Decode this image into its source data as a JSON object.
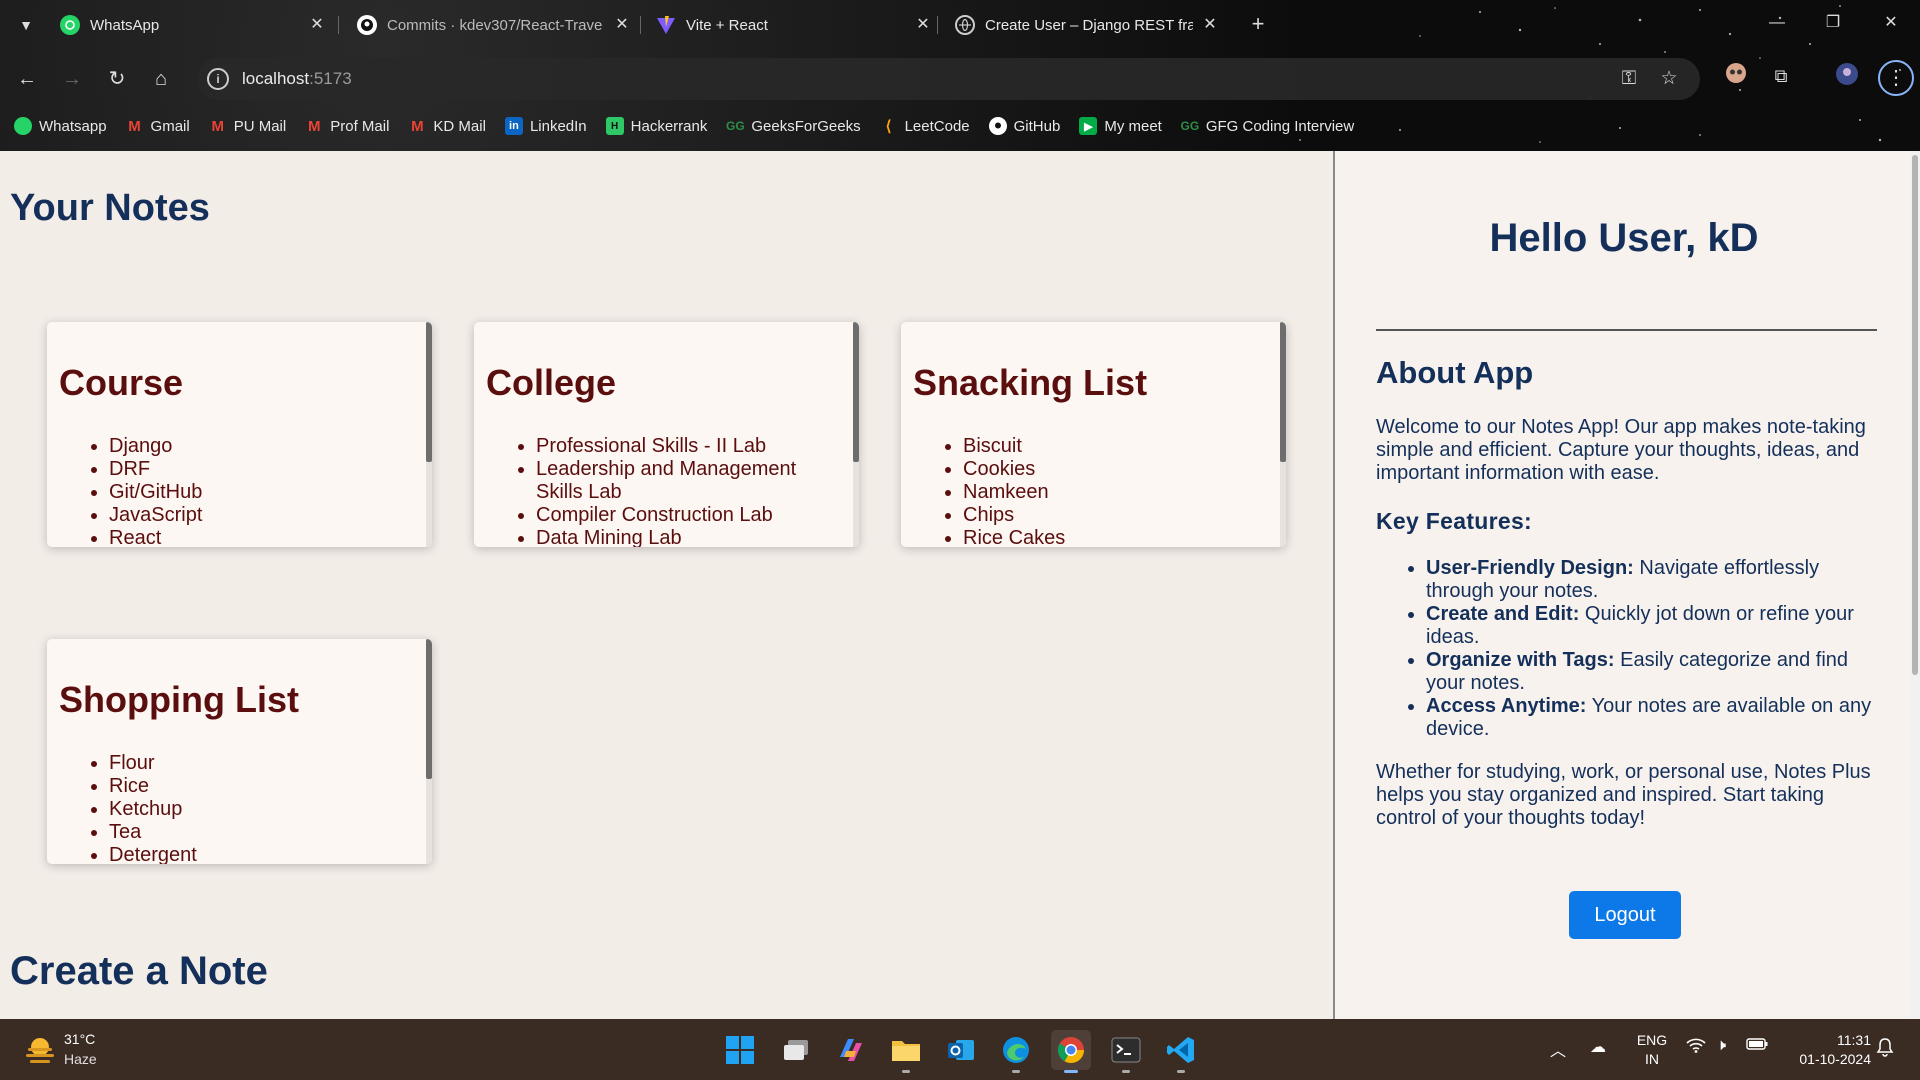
{
  "browser": {
    "tabs": [
      {
        "title": "WhatsApp",
        "icon": "whatsapp-icon"
      },
      {
        "title": "Commits · kdev307/React-Trave",
        "icon": "github-icon"
      },
      {
        "title": "Vite + React",
        "icon": "vite-icon"
      },
      {
        "title": "Create User – Django REST fram",
        "icon": "globe-icon"
      }
    ],
    "url_host": "localhost",
    "url_port": ":5173",
    "bookmarks": [
      {
        "label": "Whatsapp",
        "icon": "whatsapp-icon",
        "color": "#25d366"
      },
      {
        "label": "Gmail",
        "icon": "gmail-icon",
        "color": "#ea4335"
      },
      {
        "label": "PU Mail",
        "icon": "gmail-icon",
        "color": "#ea4335"
      },
      {
        "label": "Prof Mail",
        "icon": "gmail-icon",
        "color": "#ea4335"
      },
      {
        "label": "KD Mail",
        "icon": "gmail-icon",
        "color": "#ea4335"
      },
      {
        "label": "LinkedIn",
        "icon": "linkedin-icon",
        "color": "#0a66c2"
      },
      {
        "label": "Hackerrank",
        "icon": "hackerrank-icon",
        "color": "#2ec866"
      },
      {
        "label": "GeeksForGeeks",
        "icon": "gfg-icon",
        "color": "#2f8d46"
      },
      {
        "label": "LeetCode",
        "icon": "leetcode-icon",
        "color": "#ffa116"
      },
      {
        "label": "GitHub",
        "icon": "github-icon",
        "color": "#ffffff"
      },
      {
        "label": "My meet",
        "icon": "meet-icon",
        "color": "#00ac47"
      },
      {
        "label": "GFG Coding Interview",
        "icon": "gfg-icon",
        "color": "#2f8d46"
      }
    ]
  },
  "main": {
    "heading": "Your Notes",
    "create_heading": "Create a Note",
    "notes": [
      {
        "title": "Course",
        "items": [
          "Django",
          "DRF",
          "Git/GitHub",
          "JavaScript",
          "React"
        ]
      },
      {
        "title": "College",
        "items": [
          "Professional Skills - II Lab",
          "Leadership and Management Skills Lab",
          "Compiler Construction Lab",
          "Data Mining Lab"
        ]
      },
      {
        "title": "Snacking List",
        "items": [
          "Biscuit",
          "Cookies",
          "Namkeen",
          "Chips",
          "Rice Cakes"
        ]
      },
      {
        "title": "Shopping List",
        "items": [
          "Flour",
          "Rice",
          "Ketchup",
          "Tea",
          "Detergent"
        ]
      }
    ]
  },
  "sidebar": {
    "greeting": "Hello User, kD",
    "about_title": "About App",
    "intro": "Welcome to our Notes App! Our app makes note-taking simple and efficient. Capture your thoughts, ideas, and important information with ease.",
    "features_title": "Key Features:",
    "features": [
      {
        "name": "User-Friendly Design:",
        "desc": " Navigate effortlessly through your notes."
      },
      {
        "name": "Create and Edit:",
        "desc": " Quickly jot down or refine your ideas."
      },
      {
        "name": "Organize with Tags:",
        "desc": " Easily categorize and find your notes."
      },
      {
        "name": "Access Anytime:",
        "desc": " Your notes are available on any device."
      }
    ],
    "closing": "Whether for studying, work, or personal use, Notes Plus helps you stay organized and inspired. Start taking control of your thoughts today!",
    "logout_label": "Logout"
  },
  "taskbar": {
    "temperature": "31°C",
    "weather": "Haze",
    "lang_line1": "ENG",
    "lang_line2": "IN",
    "time": "11:31",
    "date": "01-10-2024"
  },
  "colors": {
    "heading": "#14305a",
    "note_text": "#5b0e0e",
    "logout": "#0d78e8"
  }
}
